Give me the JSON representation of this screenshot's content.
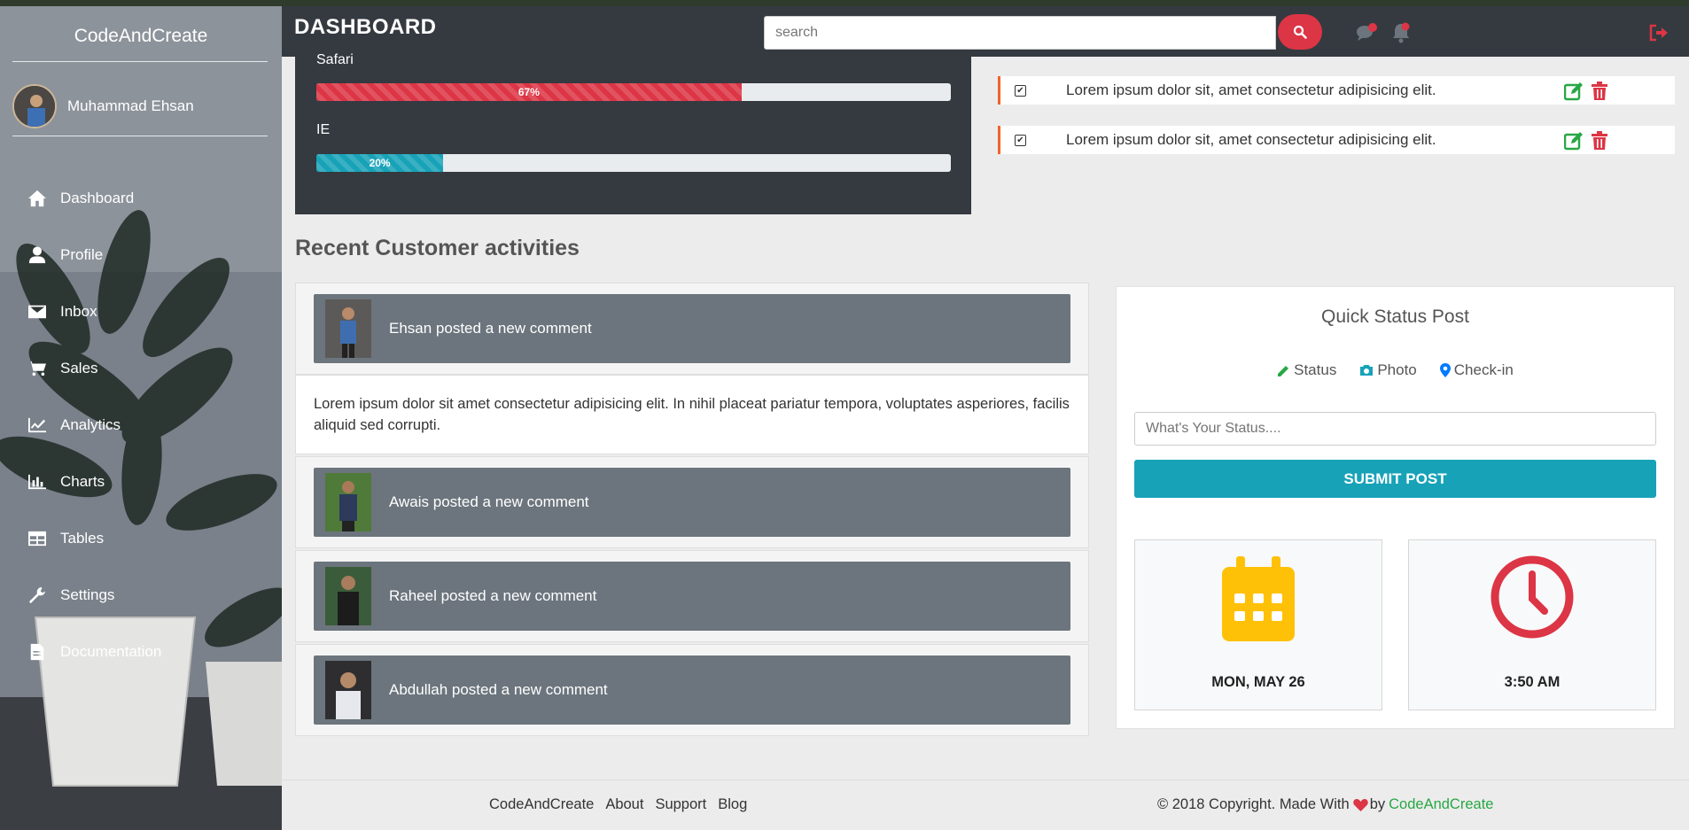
{
  "sidebar": {
    "brand": "CodeAndCreate",
    "user_name": "Muhammad Ehsan",
    "items": [
      {
        "label": "Dashboard",
        "icon": "home-icon"
      },
      {
        "label": "Profile",
        "icon": "user-icon"
      },
      {
        "label": "Inbox",
        "icon": "envelope-icon"
      },
      {
        "label": "Sales",
        "icon": "cart-icon"
      },
      {
        "label": "Analytics",
        "icon": "line-chart-icon"
      },
      {
        "label": "Charts",
        "icon": "bar-chart-icon"
      },
      {
        "label": "Tables",
        "icon": "table-icon"
      },
      {
        "label": "Settings",
        "icon": "wrench-icon"
      },
      {
        "label": "Documentation",
        "icon": "file-icon"
      }
    ]
  },
  "header": {
    "title": "DASHBOARD",
    "search_placeholder": "search",
    "icons": [
      "search-icon",
      "comments-icon",
      "bell-icon",
      "logout-icon"
    ]
  },
  "browser_stats": [
    {
      "label": "Safari",
      "percent": 67,
      "text": "67%",
      "color": "#dc3545"
    },
    {
      "label": "IE",
      "percent": 20,
      "text": "20%",
      "color": "#17a2b8"
    }
  ],
  "todos": [
    {
      "text": "Lorem ipsum dolor sit, amet consectetur adipisicing elit.",
      "checked": true
    },
    {
      "text": "Lorem ipsum dolor sit, amet consectetur adipisicing elit.",
      "checked": true
    }
  ],
  "activities": {
    "title": "Recent Customer activities",
    "items": [
      {
        "text": "Ehsan posted a new comment",
        "body": "Lorem ipsum dolor sit amet consectetur adipisicing elit. In nihil placeat pariatur tempora, voluptates asperiores, facilis aliquid sed corrupti."
      },
      {
        "text": "Awais posted a new comment"
      },
      {
        "text": "Raheel posted a new comment"
      },
      {
        "text": "Abdullah posted a new comment"
      }
    ]
  },
  "quick_status": {
    "title": "Quick Status Post",
    "tabs": [
      {
        "label": "Status",
        "icon": "pencil-icon"
      },
      {
        "label": "Photo",
        "icon": "camera-icon"
      },
      {
        "label": "Check-in",
        "icon": "map-marker-icon"
      }
    ],
    "input_placeholder": "What's Your Status....",
    "submit_label": "SUBMIT POST",
    "date": "MON, MAY 26",
    "time": "3:50 AM"
  },
  "footer": {
    "links": [
      "CodeAndCreate",
      "About",
      "Support",
      "Blog"
    ],
    "copyright": "© 2018 Copyright. Made With",
    "by": "by",
    "brand": "CodeAndCreate"
  },
  "colors": {
    "accent_red": "#dc3545",
    "accent_teal": "#17a2b8",
    "accent_green": "#28a745",
    "accent_yellow": "#ffc107",
    "dark": "#343a40",
    "todo_border": "#f0632d"
  }
}
